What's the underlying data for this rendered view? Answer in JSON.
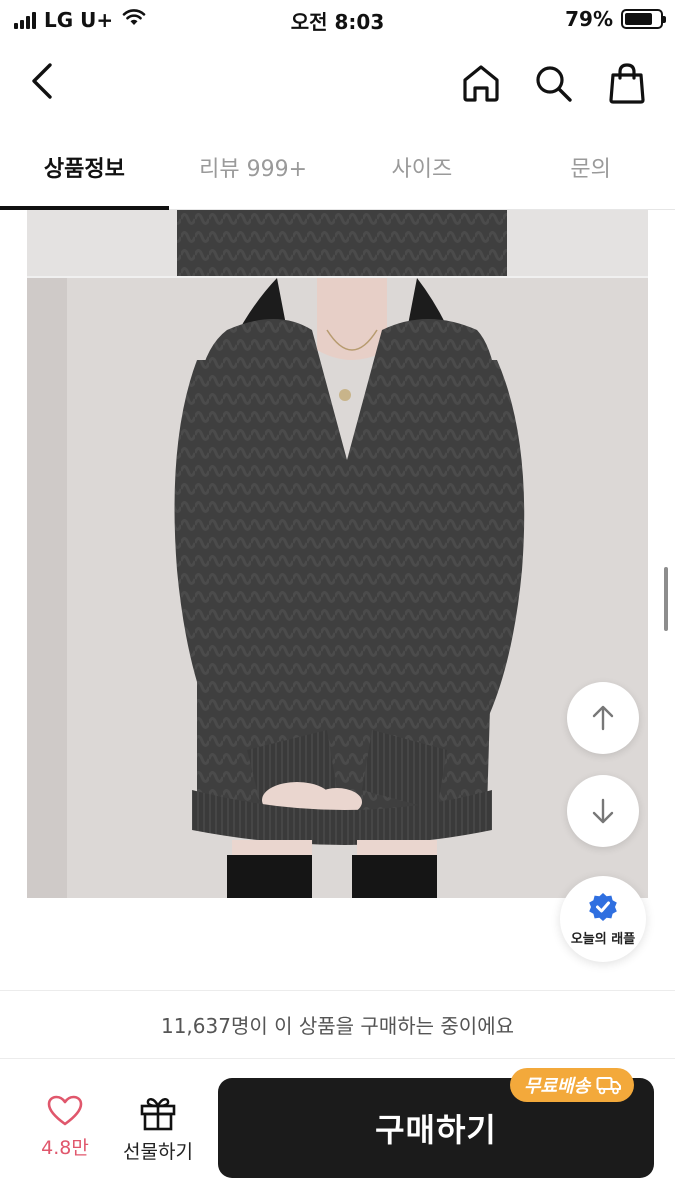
{
  "status_bar": {
    "carrier": "LG U+",
    "time": "오전 8:03",
    "battery": "79%",
    "battery_level": 0.79
  },
  "header": {
    "icons": [
      "back-arrow-icon",
      "home-icon",
      "search-icon",
      "shopping-bag-icon"
    ]
  },
  "tabs": [
    {
      "label": "상품정보",
      "active": true
    },
    {
      "label": "리뷰 999+",
      "active": false
    },
    {
      "label": "사이즈",
      "active": false
    },
    {
      "label": "문의",
      "active": false
    }
  ],
  "floating": {
    "raffle_label": "오늘의 래플"
  },
  "buyers_notice": "11,637명이 이 상품을 구매하는 중이에요",
  "bottom_bar": {
    "like_count": "4.8만",
    "gift_label": "선물하기",
    "buy_label": "구매하기",
    "free_shipping_badge": "무료배송"
  },
  "colors": {
    "accent_like": "#e0576c",
    "badge_orange": "#f3a93b",
    "buy_button": "#1b1b1b",
    "verified_blue": "#2f6fe0"
  }
}
